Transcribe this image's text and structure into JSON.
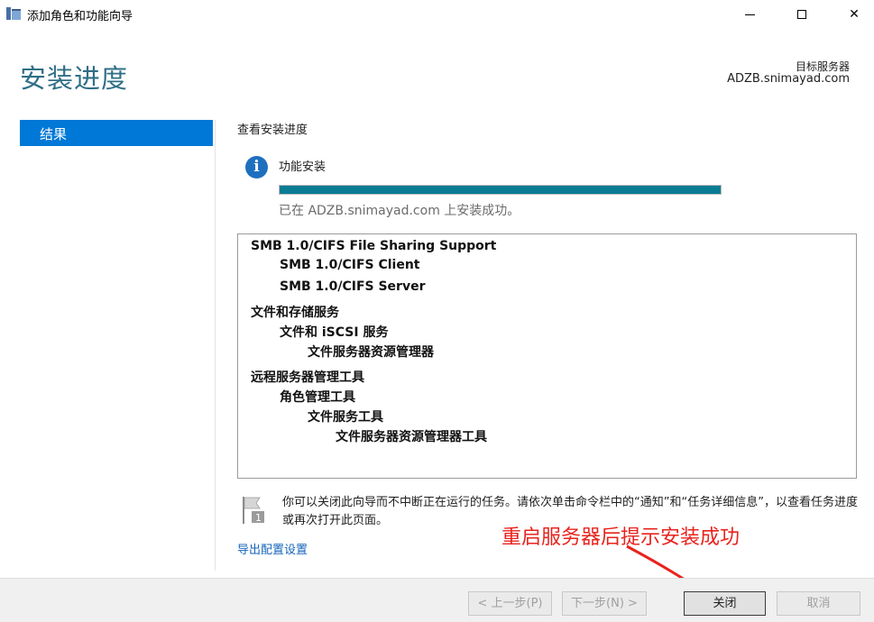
{
  "window": {
    "title": "添加角色和功能向导",
    "minimize_label": "",
    "maximize_label": "",
    "close_label": "✕"
  },
  "header": {
    "page_title": "安装进度",
    "target_label": "目标服务器",
    "target_server": "ADZB.snimayad.com"
  },
  "nav": {
    "items": [
      {
        "label": "结果",
        "selected": true
      }
    ]
  },
  "main": {
    "section_title": "查看安装进度",
    "feature_label": "功能安装",
    "progress_percent": 100,
    "status_text": "已在 ADZB.snimayad.com 上安装成功。",
    "results": [
      {
        "text": "SMB 1.0/CIFS File Sharing Support",
        "level": 0
      },
      {
        "text": "SMB 1.0/CIFS Client",
        "level": 1
      },
      {
        "text": "SMB 1.0/CIFS Server",
        "level": 1
      },
      {
        "text": "文件和存储服务",
        "level": 0
      },
      {
        "text": "文件和 iSCSI 服务",
        "level": 1
      },
      {
        "text": "文件服务器资源管理器",
        "level": 2
      },
      {
        "text": "远程服务器管理工具",
        "level": 0
      },
      {
        "text": "角色管理工具",
        "level": 1
      },
      {
        "text": "文件服务工具",
        "level": 2
      },
      {
        "text": "文件服务器资源管理器工具",
        "level": 3
      }
    ],
    "note_text": "你可以关闭此向导而不中断正在运行的任务。请依次单击命令栏中的“通知”和“任务详细信息”，以查看任务进度或再次打开此页面。",
    "export_link": "导出配置设置"
  },
  "annotation": {
    "text": "重启服务器后提示安装成功",
    "color": "#e8231e"
  },
  "footer": {
    "prev_label": "< 上一步(P)",
    "next_label": "下一步(N) >",
    "close_label": "关闭",
    "cancel_label": "取消"
  },
  "colors": {
    "accent": "#0078d7",
    "title": "#2f6f86",
    "progress": "#0a7c94",
    "link": "#1565b8"
  }
}
